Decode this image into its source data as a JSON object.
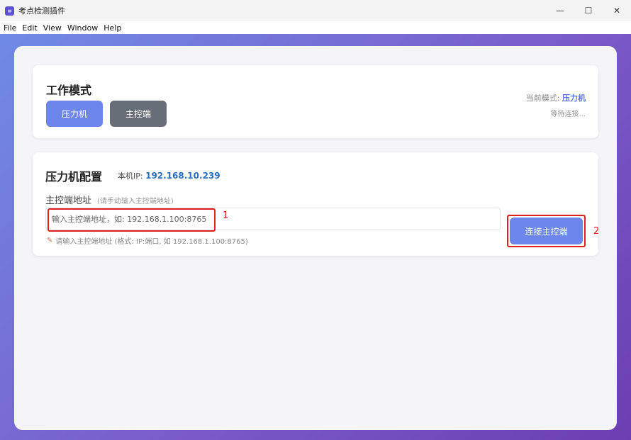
{
  "window": {
    "title": "考点检测插件",
    "icon_glyph": "≡",
    "minimize_glyph": "—",
    "maximize_glyph": "☐",
    "close_glyph": "✕"
  },
  "menu": [
    "File",
    "Edit",
    "View",
    "Window",
    "Help"
  ],
  "mode": {
    "title": "工作模式",
    "buttons": {
      "press": "压力机",
      "master": "主控端"
    },
    "current_label": "当前模式: ",
    "current_value": "压力机",
    "status": "等待连接..."
  },
  "config": {
    "title": "压力机配置",
    "local_ip_label": "本机IP: ",
    "local_ip": "192.168.10.239",
    "address_label": "主控端地址",
    "address_hint": "(请手动输入主控端地址)",
    "address_placeholder": "输入主控端地址，如: 192.168.1.100:8765",
    "address_value": "",
    "format_hint": "请输入主控端地址 (格式: IP:端口, 如 192.168.1.100:8765)",
    "connect_button": "连接主控端"
  },
  "annotations": {
    "n1": "1",
    "n2": "2"
  },
  "colors": {
    "accent": "#6d86ec",
    "secondary": "#676e78",
    "highlight": "#e02020",
    "ip": "#2a6fbf"
  },
  "icons": {
    "format_hint": "pencil-icon"
  }
}
